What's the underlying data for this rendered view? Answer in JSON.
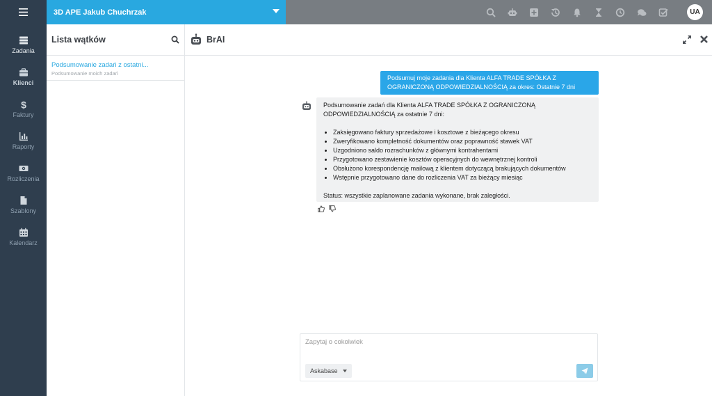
{
  "topbar": {
    "company_name": "3D APE Jakub Chuchrzak",
    "icons": [
      "search-icon",
      "robot-icon",
      "plus-square-icon",
      "history-icon",
      "bell-icon",
      "hourglass-icon",
      "clock-icon",
      "chat-icon",
      "checkbox-icon"
    ],
    "avatar_initials": "UA",
    "colors": {
      "bar": "#787d82",
      "company": "#29a8e0",
      "sidebar": "#2f3e4e"
    }
  },
  "sidebar": {
    "items": [
      {
        "label": "Zadania",
        "icon": "tasks-icon"
      },
      {
        "label": "Klienci",
        "icon": "briefcase-icon"
      },
      {
        "label": "Faktury",
        "icon": "dollar-icon"
      },
      {
        "label": "Raporty",
        "icon": "chart-icon"
      },
      {
        "label": "Rozliczenia",
        "icon": "money-icon"
      },
      {
        "label": "Szablony",
        "icon": "file-icon"
      },
      {
        "label": "Kalendarz",
        "icon": "calendar-icon"
      }
    ]
  },
  "threads": {
    "title": "Lista wątków",
    "items": [
      {
        "title": "Podsumowanie zadań z ostatni...",
        "subtitle": "Podsumowanie moich zadań"
      }
    ]
  },
  "chat": {
    "title": "BrAI",
    "user_message": "Podsumuj moje zadania dla Klienta ALFA TRADE SPÓŁKA Z OGRANICZONĄ ODPOWIEDZIALNOŚCIĄ za okres: Ostatnie 7 dni",
    "bot_message": {
      "intro": "Podsumowanie zadań dla Klienta ALFA TRADE SPÓŁKA Z OGRANICZONĄ ODPOWIEDZIALNOŚCIĄ za ostatnie 7 dni:",
      "bullets": [
        "Zaksięgowano faktury sprzedażowe i kosztowe z bieżącego okresu",
        "Zweryfikowano kompletność dokumentów oraz poprawność stawek VAT",
        "Uzgodniono saldo rozrachunków z głównymi kontrahentami",
        "Przygotowano zestawienie kosztów operacyjnych do wewnętrznej kontroli",
        "Obsłużono korespondencję mailową z klientem dotyczącą brakujących dokumentów",
        "Wstępnie przygotowano dane do rozliczenia VAT za bieżący miesiąc"
      ],
      "status": "Status: wszystkie zaplanowane zadania wykonane, brak zaległości."
    },
    "colors": {
      "user_bubble": "#2aa6e8",
      "bot_bubble": "#f0f1f2"
    }
  },
  "composer": {
    "placeholder": "Zapytaj o cokolwiek",
    "value": "",
    "knowledge_base": "Askabase"
  }
}
